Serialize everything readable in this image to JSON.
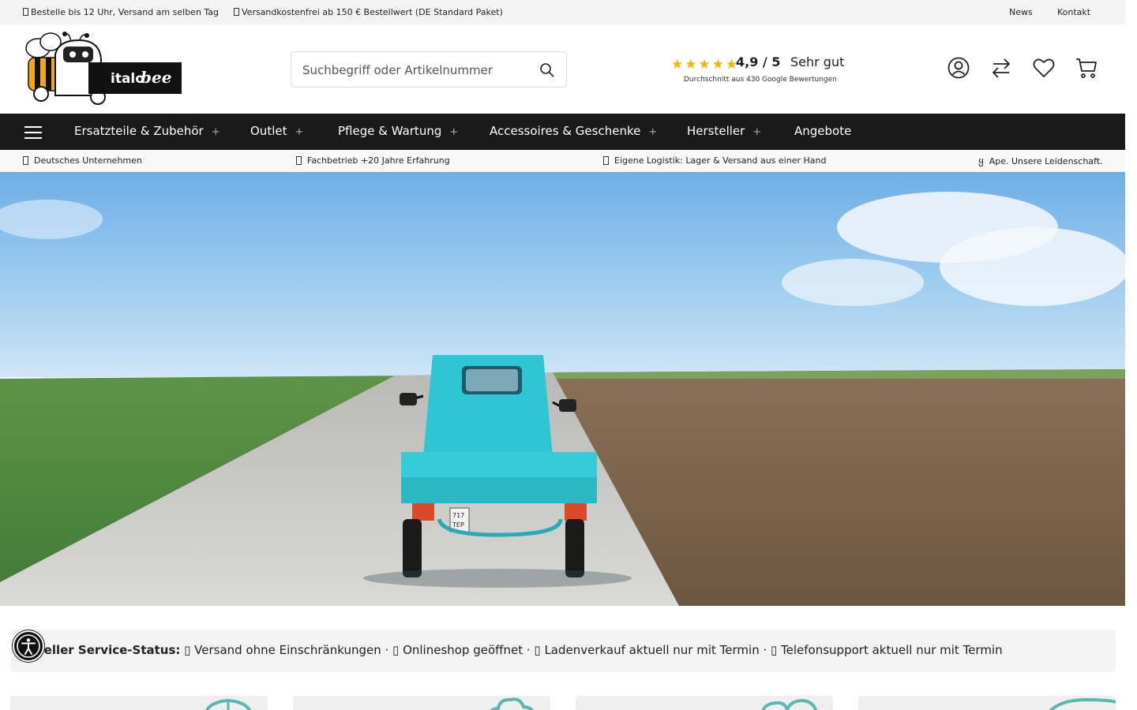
{
  "topbar": {
    "msg1": "Bestelle bis 12 Uhr, Versand am selben Tag",
    "msg2": "Versandkostenfrei ab 150 € Bestellwert (DE Standard Paket)",
    "news": "News",
    "contact": "Kontakt"
  },
  "header": {
    "logo_text_a": "italo",
    "logo_text_b": "bee",
    "search_placeholder": "Suchbegriff oder Artikelnummer",
    "rating": {
      "stars": "★★★★★",
      "score": "4,9 / 5",
      "verdict": "Sehr gut",
      "sub": "Durchschnitt aus 430 Google Bewertungen"
    },
    "icons": [
      "account-icon",
      "compare-icon",
      "wishlist-icon",
      "cart-icon"
    ]
  },
  "nav": {
    "items": [
      {
        "label": "Ersatzteile & Zubehör",
        "plus": "+"
      },
      {
        "label": "Outlet",
        "plus": "+"
      },
      {
        "label": "Pflege & Wartung",
        "plus": "+"
      },
      {
        "label": "Accessoires & Geschenke",
        "plus": "+"
      },
      {
        "label": "Hersteller",
        "plus": "+"
      },
      {
        "label": "Angebote",
        "plus": ""
      }
    ]
  },
  "usp": [
    "Deutsches Unternehmen",
    "Fachbetrieb +20 Jahre Erfahrung",
    "Eigene Logistik: Lager & Versand aus einer Hand",
    "Ape. Unsere Leidenschaft."
  ],
  "usp_glyph_last": "ყ",
  "hero": {
    "plate_line1": "717",
    "plate_line2": "TEP"
  },
  "status": {
    "label": "ueller Service-Status:",
    "text": " ▯ Versand ohne Einschränkungen · ▯ Onlineshop geöffnet · ▯ Ladenverkauf aktuell nur mit Termin · ▯ Telefonsupport aktuell nur mit Termin"
  },
  "colors": {
    "nav_bg": "#1a1a1a",
    "star": "#f5b400",
    "accent_teal": "#5ab8b0",
    "ape_blue": "#2fc6d3"
  }
}
